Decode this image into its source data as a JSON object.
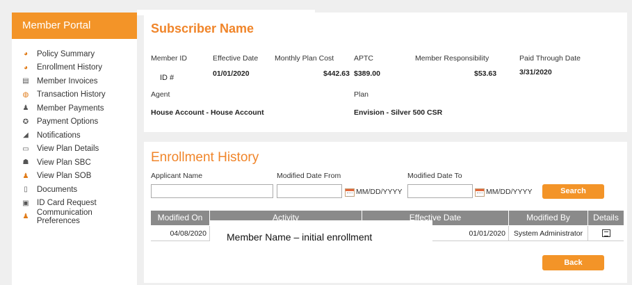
{
  "sidebar": {
    "title": "Member Portal",
    "items": [
      {
        "label": "Policy Summary",
        "icon": "pie-chart-icon"
      },
      {
        "label": "Enrollment History",
        "icon": "pie-chart-icon"
      },
      {
        "label": "Member Invoices",
        "icon": "invoice-icon"
      },
      {
        "label": "Transaction History",
        "icon": "history-icon"
      },
      {
        "label": "Member Payments",
        "icon": "payment-person-icon"
      },
      {
        "label": "Payment Options",
        "icon": "gear-icon"
      },
      {
        "label": "Notifications",
        "icon": "megaphone-icon"
      },
      {
        "label": "View Plan Details",
        "icon": "plan-card-icon"
      },
      {
        "label": "View Plan SBC",
        "icon": "people-icon"
      },
      {
        "label": "View Plan SOB",
        "icon": "person-icon"
      },
      {
        "label": "Documents",
        "icon": "document-icon"
      },
      {
        "label": "ID Card Request",
        "icon": "id-card-icon"
      },
      {
        "label": "Communication Preferences",
        "icon": "communication-person-icon"
      }
    ]
  },
  "subscriber": {
    "title": "Subscriber Name",
    "labels": {
      "member_id": "Member ID",
      "effective_date": "Effective Date",
      "monthly_plan_cost": "Monthly Plan Cost",
      "aptc": "APTC",
      "member_responsibility": "Member Responsibility",
      "paid_through_date": "Paid Through Date",
      "agent": "Agent",
      "plan": "Plan"
    },
    "values": {
      "member_id": "ID #",
      "effective_date": "01/01/2020",
      "monthly_plan_cost": "$442.63",
      "aptc": "$389.00",
      "member_responsibility": "$53.63",
      "paid_through_date": "3/31/2020",
      "agent": "House Account - House Account",
      "plan": "Envision - Silver 500 CSR"
    }
  },
  "enrollment": {
    "title": "Enrollment History",
    "applicant_name_label": "Applicant Name",
    "applicant_name_value": "",
    "modified_from_label": "Modified Date From",
    "modified_from_value": "",
    "modified_from_hint": "MM/DD/YYYY",
    "modified_to_label": "Modified Date To",
    "modified_to_value": "",
    "modified_to_hint": "MM/DD/YYYY",
    "search_label": "Search",
    "back_label": "Back",
    "columns": [
      "Modified On",
      "Activity",
      "Effective Date",
      "Modified By",
      "Details"
    ],
    "rows": [
      {
        "modified_on": "04/08/2020",
        "activity": "Member Name – initial enrollment",
        "effective_date": "01/01/2020",
        "modified_by": "System Administrator",
        "details_icon": "details-icon"
      }
    ]
  },
  "colors": {
    "accent": "#f39428",
    "title_orange": "#f0852a",
    "grid_header": "#8a8a8a"
  }
}
